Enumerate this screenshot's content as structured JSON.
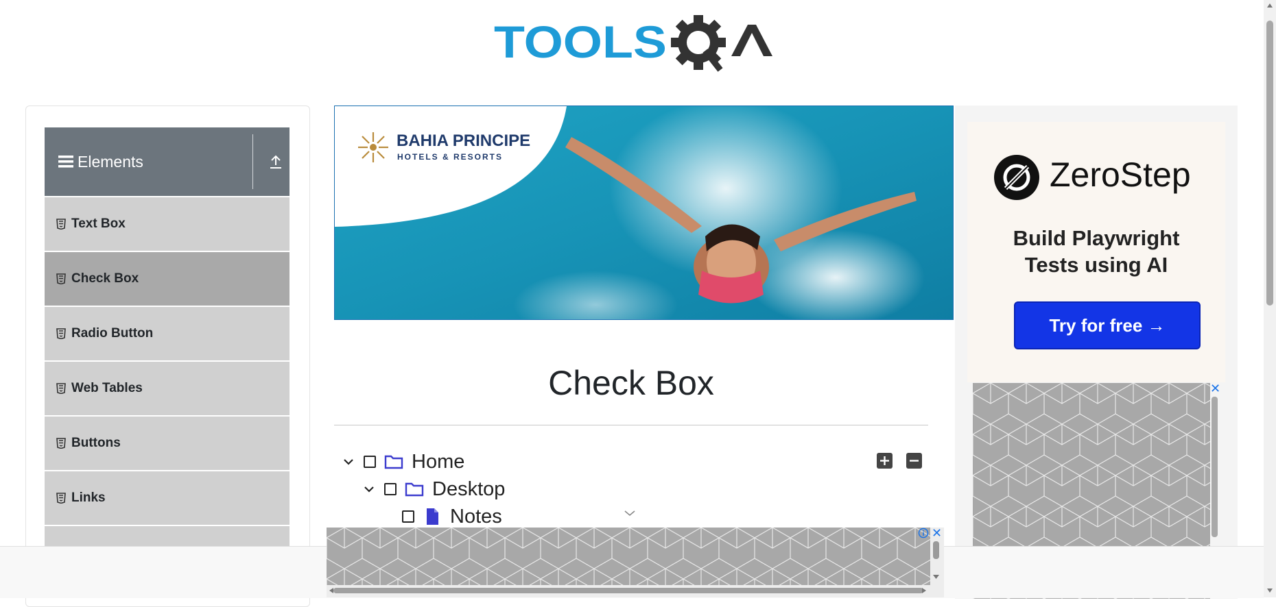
{
  "site": {
    "logo_text": "TOOLSQA"
  },
  "sidebar": {
    "group_title": "Elements",
    "items": [
      {
        "label": "Text Box",
        "active": false
      },
      {
        "label": "Check Box",
        "active": true
      },
      {
        "label": "Radio Button",
        "active": false
      },
      {
        "label": "Web Tables",
        "active": false
      },
      {
        "label": "Buttons",
        "active": false
      },
      {
        "label": "Links",
        "active": false
      },
      {
        "label": "",
        "active": false
      }
    ]
  },
  "banner_ad": {
    "brand_line1": "BAHIA PRINCIPE",
    "brand_line2": "HOTELS & RESORTS"
  },
  "right_ad": {
    "brand": "ZeroStep",
    "headline_line1": "Build Playwright",
    "headline_line2": "Tests using AI",
    "cta": "Try for free →"
  },
  "main": {
    "title": "Check Box",
    "tree": [
      {
        "label": "Home",
        "type": "folder",
        "expanded": true,
        "checked": false
      },
      {
        "label": "Desktop",
        "type": "folder",
        "expanded": true,
        "checked": false
      },
      {
        "label": "Notes",
        "type": "file",
        "checked": false
      }
    ],
    "expand_all_icon": "plus-square-icon",
    "collapse_all_icon": "minus-square-icon"
  },
  "colors": {
    "logo_blue": "#1e9bd7",
    "logo_dark": "#333333",
    "sidebar_header": "#6c757d",
    "menu_item": "#d0d0d0",
    "menu_item_active": "#a9a9a9",
    "cta_blue": "#1335e6",
    "folder_blue": "#3b3bce"
  }
}
